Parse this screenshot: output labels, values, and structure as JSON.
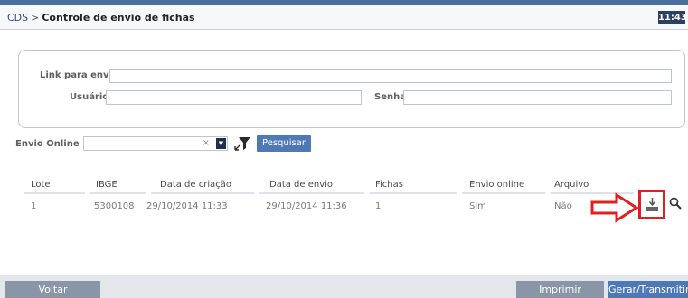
{
  "breadcrumb": {
    "root": "CDS",
    "separator": ">",
    "current": "Controle de envio de fichas"
  },
  "clock": "11:43",
  "form": {
    "link_label": "Link para envio",
    "link_value": "",
    "user_label": "Usuário",
    "user_value": "",
    "password_label": "Senha",
    "password_value": ""
  },
  "filter": {
    "label": "Envio Online",
    "selected": "",
    "clear_glyph": "×",
    "dropdown_glyph": "▼",
    "search_label": "Pesquisar",
    "filter_icon": "filter-icon"
  },
  "table": {
    "headers": [
      "Lote",
      "IBGE",
      "Data de criação",
      "Data de envio",
      "Fichas",
      "Envio online",
      "Arquivo"
    ],
    "rows": [
      [
        "1",
        "5300108",
        "29/10/2014 11:33",
        "29/10/2014 11:36",
        "1",
        "Sim",
        "Não"
      ]
    ],
    "row_icons": [
      "arrow-right-icon",
      "download-icon",
      "magnifier-icon"
    ]
  },
  "colors": {
    "highlight": "#e02020",
    "primary_button": "#4f79b6",
    "secondary_button": "#8a96a8",
    "header_bar": "#4a6e9e"
  },
  "footer": {
    "back_label": "Voltar",
    "print_label": "Imprimir",
    "generate_label": "Gerar/Transmitir"
  }
}
